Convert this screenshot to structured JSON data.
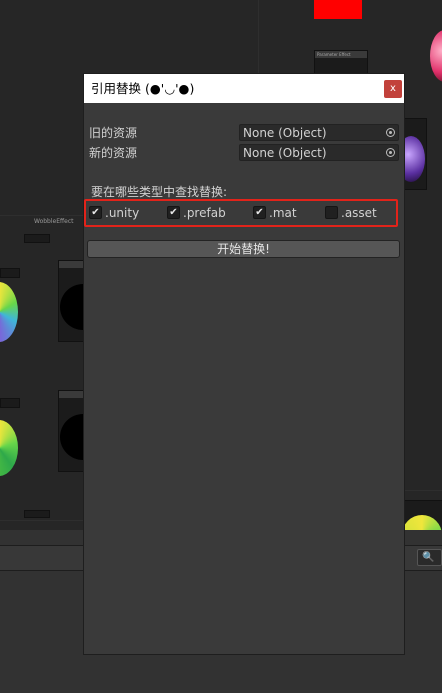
{
  "dialog": {
    "title": "引用替换 (●'◡'●)",
    "close_label": "x",
    "old_asset_label": "旧的资源",
    "old_asset_value": "None (Object)",
    "new_asset_label": "新的资源",
    "new_asset_value": "None (Object)",
    "search_types_label": "要在哪些类型中查找替换:",
    "types": [
      {
        "label": ".unity",
        "checked": true
      },
      {
        "label": ".prefab",
        "checked": true
      },
      {
        "label": ".mat",
        "checked": true
      },
      {
        "label": ".asset",
        "checked": false
      }
    ],
    "start_button": "开始替换!"
  },
  "background": {
    "node_group_label": "WobbleEffect",
    "node_title": "Parameter Effect",
    "search_icon": "🔍",
    "accent_red": "#ff0000",
    "highlight_red": "#e2231a"
  }
}
